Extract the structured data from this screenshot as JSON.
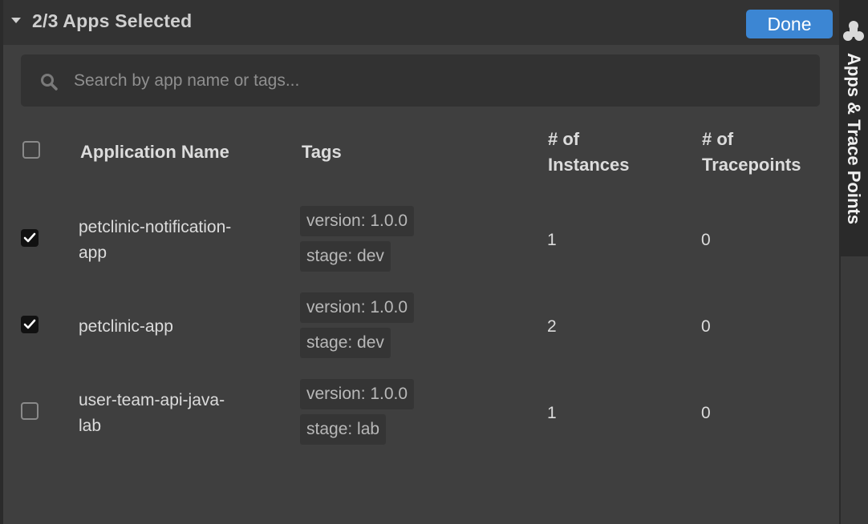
{
  "header": {
    "title": "2/3 Apps Selected",
    "done_label": "Done"
  },
  "search": {
    "placeholder": "Search by app name or tags..."
  },
  "table": {
    "columns": {
      "name": "Application Name",
      "tags": "Tags",
      "instances_line1": "# of",
      "instances_line2": "Instances",
      "tracepoints_line1": "# of",
      "tracepoints_line2": "Tracepoints"
    },
    "rows": [
      {
        "name_line1": "petclinic-notification-",
        "name_line2": "app",
        "checked": true,
        "tags": [
          "version: 1.0.0",
          "stage: dev"
        ],
        "instances": "1",
        "tracepoints": "0"
      },
      {
        "name_line1": "petclinic-app",
        "name_line2": "",
        "checked": true,
        "tags": [
          "version: 1.0.0",
          "stage: dev"
        ],
        "instances": "2",
        "tracepoints": "0"
      },
      {
        "name_line1": "user-team-api-java-",
        "name_line2": "lab",
        "checked": false,
        "tags": [
          "version: 1.0.0",
          "stage: lab"
        ],
        "instances": "1",
        "tracepoints": "0"
      }
    ]
  },
  "side_tab": {
    "label": "Apps & Trace Points",
    "icon": "app-logo-icon"
  },
  "colors": {
    "accent": "#3c86d3",
    "background": "#3f3f3f",
    "header": "#333333"
  }
}
